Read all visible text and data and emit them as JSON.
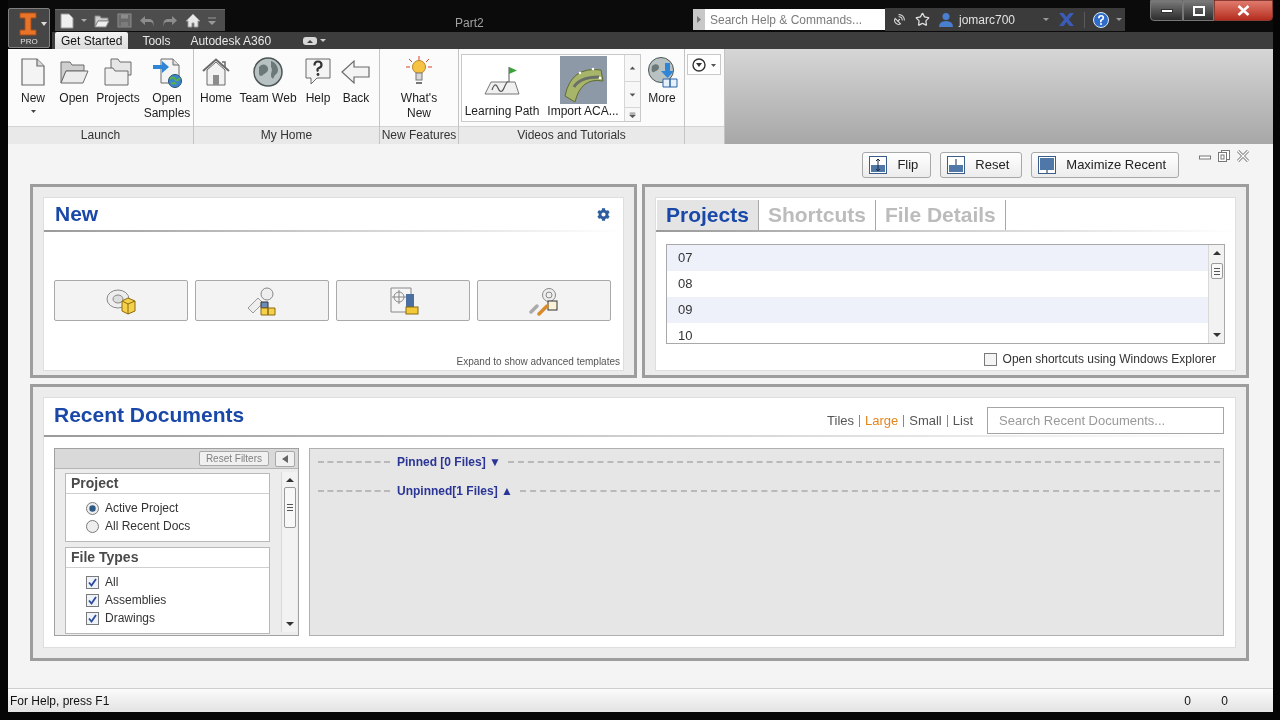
{
  "window": {
    "title": "Part2",
    "app_button": "PRO",
    "search": {
      "placeholder": "Search Help & Commands..."
    },
    "user": "jomarc700"
  },
  "tabs": [
    {
      "label": "Get Started",
      "selected": true
    },
    {
      "label": "Tools",
      "selected": false
    },
    {
      "label": "Autodesk A360",
      "selected": false
    }
  ],
  "ribbon": {
    "panels": [
      {
        "title": "Launch",
        "buttons": [
          {
            "label": "New",
            "kind": "split"
          },
          {
            "label": "Open",
            "kind": "large"
          },
          {
            "label": "Projects",
            "kind": "large"
          },
          {
            "label": "Open Samples",
            "kind": "large"
          }
        ]
      },
      {
        "title": "My Home",
        "buttons": [
          {
            "label": "Home",
            "kind": "large"
          },
          {
            "label": "Team Web",
            "kind": "large"
          },
          {
            "label": "Help",
            "kind": "large"
          },
          {
            "label": "Back",
            "kind": "large"
          }
        ]
      },
      {
        "title": "New Features",
        "buttons": [
          {
            "label": "What's New",
            "kind": "large"
          }
        ]
      },
      {
        "title": "Videos and Tutorials",
        "buttons": [
          {
            "label": "Learning Path",
            "kind": "gallery"
          },
          {
            "label": "Import ACA...",
            "kind": "gallery"
          },
          {
            "label": "More",
            "kind": "large"
          }
        ]
      }
    ]
  },
  "view_buttons": [
    "Flip",
    "Reset",
    "Maximize Recent"
  ],
  "new_panel": {
    "title": "New",
    "note": "Expand to show advanced templates"
  },
  "projects_panel": {
    "tabs": [
      {
        "label": "Projects",
        "selected": true
      },
      {
        "label": "Shortcuts",
        "selected": false
      },
      {
        "label": "File Details",
        "selected": false
      }
    ],
    "projects": [
      "07",
      "08",
      "09",
      "10"
    ],
    "option": {
      "label": "Open shortcuts using Windows Explorer",
      "checked": false
    }
  },
  "recent_documents": {
    "title": "Recent Documents",
    "views": [
      {
        "label": "Tiles",
        "selected": false
      },
      {
        "label": "Large",
        "selected": true
      },
      {
        "label": "Small",
        "selected": false
      },
      {
        "label": "List",
        "selected": false
      }
    ],
    "search": {
      "placeholder": "Search Recent Documents..."
    },
    "filters": {
      "reset_button": {
        "label": "Reset Filters",
        "disabled": true
      },
      "groups": [
        {
          "title": "Project",
          "kind": "radio",
          "items": [
            {
              "label": "Active Project",
              "selected": true
            },
            {
              "label": "All Recent Docs",
              "selected": false
            }
          ]
        },
        {
          "title": "File Types",
          "kind": "checkbox",
          "items": [
            {
              "label": "All",
              "checked": true
            },
            {
              "label": "Assemblies",
              "checked": true
            },
            {
              "label": "Drawings",
              "checked": true
            }
          ]
        }
      ]
    },
    "sections": [
      {
        "label": "Pinned [0 Files] ▼"
      },
      {
        "label": "Unpinned[1 Files] ▲"
      }
    ]
  },
  "status_bar": {
    "text": "For Help, press F1",
    "counters": [
      "0",
      "0"
    ]
  }
}
